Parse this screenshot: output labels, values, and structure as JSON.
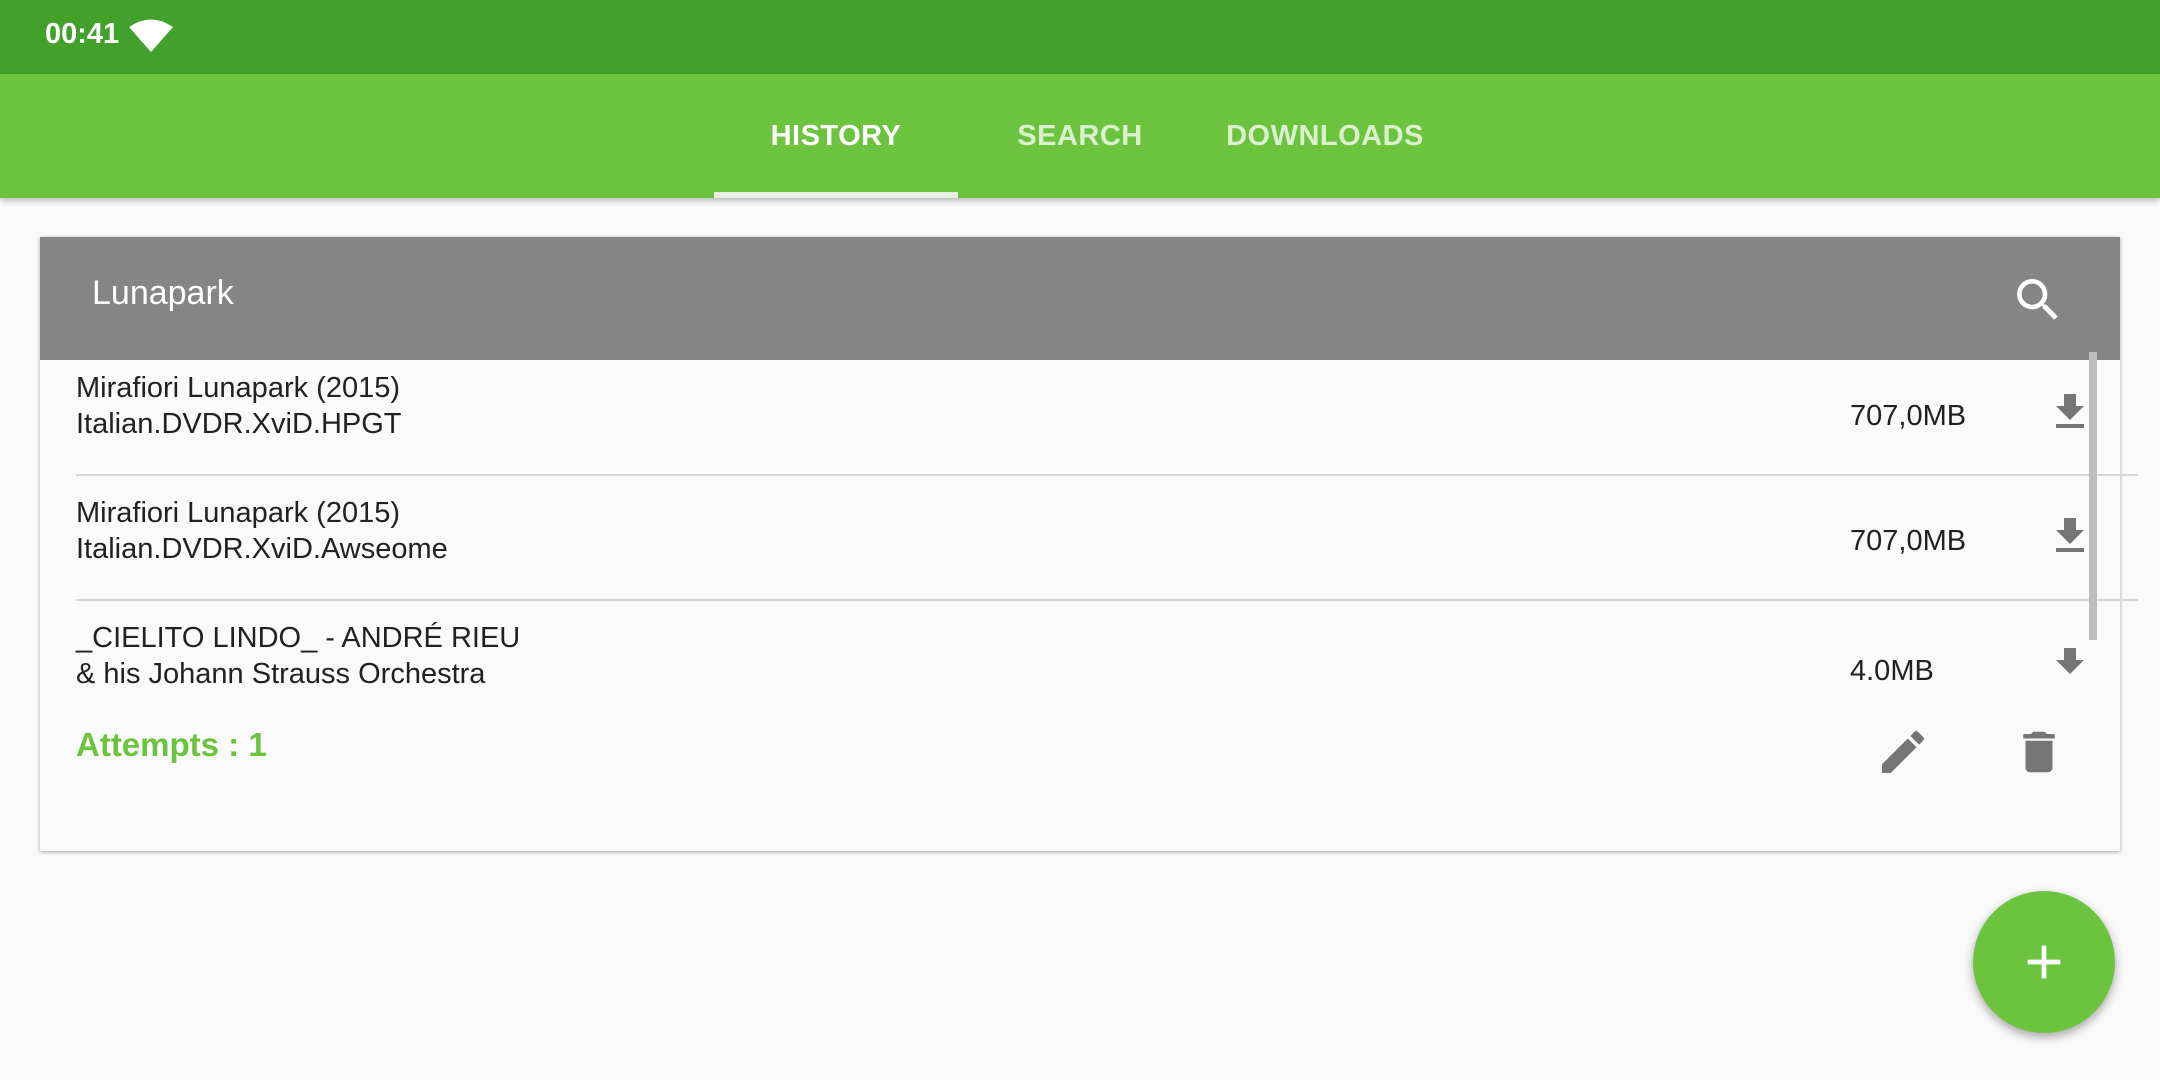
{
  "status_bar": {
    "time": "00:41",
    "wifi_icon": "wifi-icon"
  },
  "tabs": [
    {
      "label": "HISTORY",
      "active": true
    },
    {
      "label": "SEARCH",
      "active": false
    },
    {
      "label": "DOWNLOADS",
      "active": false
    }
  ],
  "history_card": {
    "query": "Lunapark",
    "search_icon": "search-icon",
    "items": [
      {
        "title_line1": "Mirafiori Lunapark (2015)",
        "title_line2": "Italian.DVDR.XviD.HPGT",
        "size": "707,0MB"
      },
      {
        "title_line1": "Mirafiori Lunapark (2015)",
        "title_line2": "Italian.DVDR.XviD.Awseome",
        "size": "707,0MB"
      },
      {
        "title_line1": "_CIELITO LINDO_ - ANDRÉ RIEU",
        "title_line2": "& his Johann Strauss Orchestra",
        "size": "4.0MB"
      }
    ],
    "attempts_label": "Attempts : 1",
    "edit_icon": "pencil-icon",
    "delete_icon": "trash-icon"
  },
  "fab": {
    "icon": "plus-icon"
  },
  "colors": {
    "status_bar": "#42a12a",
    "app_bar": "#6cc43e",
    "card_header": "#858585",
    "accent": "#6cc43e"
  }
}
